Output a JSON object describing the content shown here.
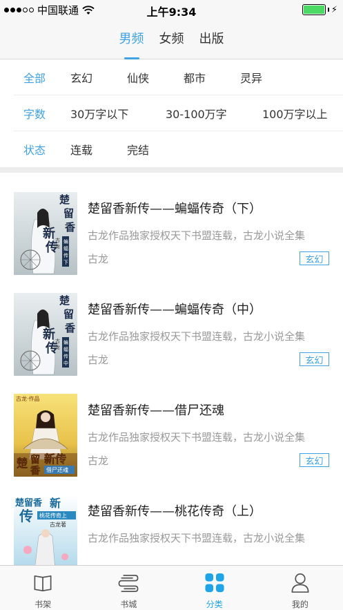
{
  "status_bar": {
    "carrier": "中国联通",
    "time": "上午9:34"
  },
  "top_tabs": [
    {
      "label": "男频",
      "active": true
    },
    {
      "label": "女频",
      "active": false
    },
    {
      "label": "出版",
      "active": false
    }
  ],
  "filters": {
    "category": {
      "options": [
        "全部",
        "玄幻",
        "仙侠",
        "都市",
        "灵异"
      ]
    },
    "wordcount": {
      "label": "字数",
      "options": [
        "30万字以下",
        "30-100万字",
        "100万字以上"
      ]
    },
    "status": {
      "label": "状态",
      "options": [
        "连载",
        "完结"
      ]
    }
  },
  "books": [
    {
      "title": "楚留香新传——蝙蝠传奇（下）",
      "desc": "古龙作品独家授权天下书盟连载，古龙小说全集",
      "author": "古龙",
      "tag": "玄幻",
      "cover_text": "楚留香新传",
      "cover_sub": "蝙蝠传奇·下",
      "cover_author": "古龙·著"
    },
    {
      "title": "楚留香新传——蝙蝠传奇（中）",
      "desc": "古龙作品独家授权天下书盟连载，古龙小说全集",
      "author": "古龙",
      "tag": "玄幻",
      "cover_text": "楚留香新传",
      "cover_sub": "蝙蝠传奇·中",
      "cover_author": "古龙·著"
    },
    {
      "title": "楚留香新传——借尸还魂",
      "desc": "古龙作品独家授权天下书盟连载，古龙小说全集",
      "author": "古龙",
      "tag": "玄幻",
      "cover_top": "古龙·作品",
      "cover_text": "楚留香新传",
      "cover_sub": "借尸还魂"
    },
    {
      "title": "楚留香新传——桃花传奇（上）",
      "desc": "古龙作品独家授权天下书盟连载，古龙小说全集",
      "cover_text": "楚留香新传",
      "cover_sub": "桃花传奇上",
      "cover_author": "古龙著"
    }
  ],
  "bottom_nav": [
    {
      "label": "书架",
      "icon": "book-icon"
    },
    {
      "label": "书城",
      "icon": "store-icon"
    },
    {
      "label": "分类",
      "icon": "grid-icon",
      "active": true
    },
    {
      "label": "我的",
      "icon": "person-icon"
    }
  ]
}
